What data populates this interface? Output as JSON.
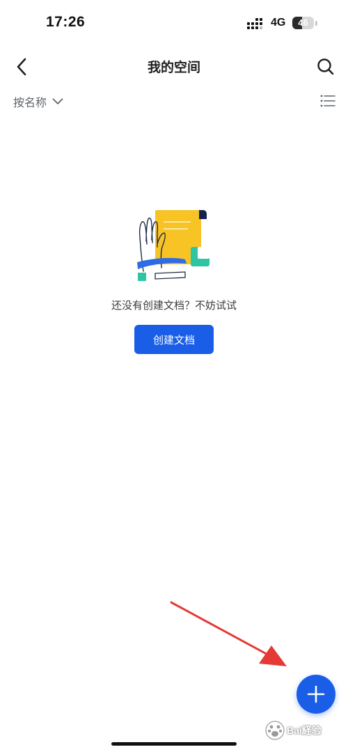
{
  "status_bar": {
    "time": "17:26",
    "network": "4G",
    "battery_level": "46",
    "battery_fraction": 0.46
  },
  "nav": {
    "title": "我的空间",
    "back_icon": "chevron-left-icon",
    "search_icon": "search-icon"
  },
  "toolbar": {
    "sort_label": "按名称",
    "sort_icon": "chevron-down-icon",
    "view_icon": "list-view-icon"
  },
  "empty_state": {
    "message": "还没有创建文档？不妨试试",
    "button_label": "创建文档"
  },
  "fab": {
    "icon": "plus-icon"
  },
  "watermark": {
    "text": "Bai経验"
  },
  "colors": {
    "primary": "#1a5ee8",
    "illustration_yellow": "#f7c325",
    "illustration_teal": "#2ec5a3",
    "illustration_navy": "#16244d",
    "annotation_red": "#e53935"
  }
}
